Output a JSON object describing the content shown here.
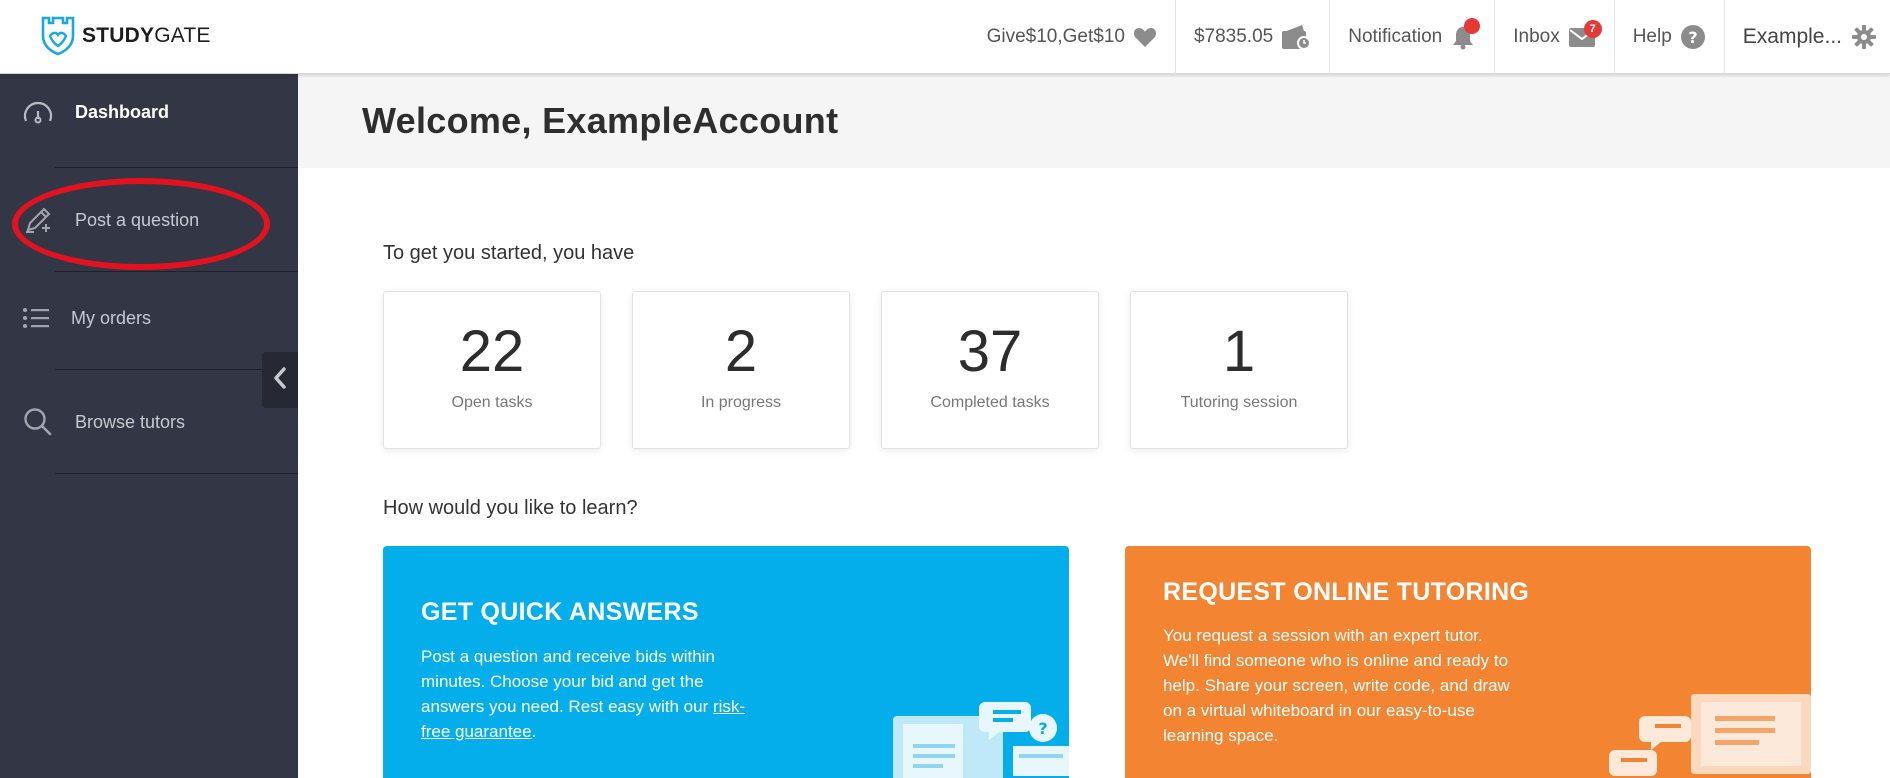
{
  "brand": {
    "name_bold": "STUDY",
    "name_rest": "GATE"
  },
  "topnav": {
    "referral": "Give$10,Get$10",
    "balance": "$7835.05",
    "notification": "Notification",
    "inbox": "Inbox",
    "inbox_count": "7",
    "help": "Help",
    "account": "Example..."
  },
  "sidebar": {
    "items": [
      {
        "label": "Dashboard",
        "icon": "gauge-icon"
      },
      {
        "label": "Post a question",
        "icon": "pencil-plus-icon"
      },
      {
        "label": "My orders",
        "icon": "list-icon"
      },
      {
        "label": "Browse tutors",
        "icon": "search-icon"
      }
    ]
  },
  "main": {
    "welcome": "Welcome, ExampleAccount",
    "started_label": "To get you started, you have",
    "stats": [
      {
        "value": "22",
        "label": "Open tasks"
      },
      {
        "value": "2",
        "label": "In progress"
      },
      {
        "value": "37",
        "label": "Completed tasks"
      },
      {
        "value": "1",
        "label": "Tutoring session"
      }
    ],
    "learn_label": "How would you like to learn?",
    "quick": {
      "title": "GET QUICK ANSWERS",
      "body": "Post a question and receive bids within minutes. Choose your bid and get the answers you need. Rest easy with our ",
      "link": "risk-free guarantee",
      "end": "."
    },
    "tutoring": {
      "title": "REQUEST ONLINE TUTORING",
      "body": "You request a session with an expert tutor. We'll find someone who is online and ready to help. Share your screen, write code, and draw on a virtual whiteboard in our easy-to-use learning space."
    }
  },
  "colors": {
    "sidebar": "#333644",
    "blue_card": "#04aeea",
    "orange_card": "#f38432",
    "highlight": "#e4121f",
    "logo": "#1aa7e6"
  }
}
